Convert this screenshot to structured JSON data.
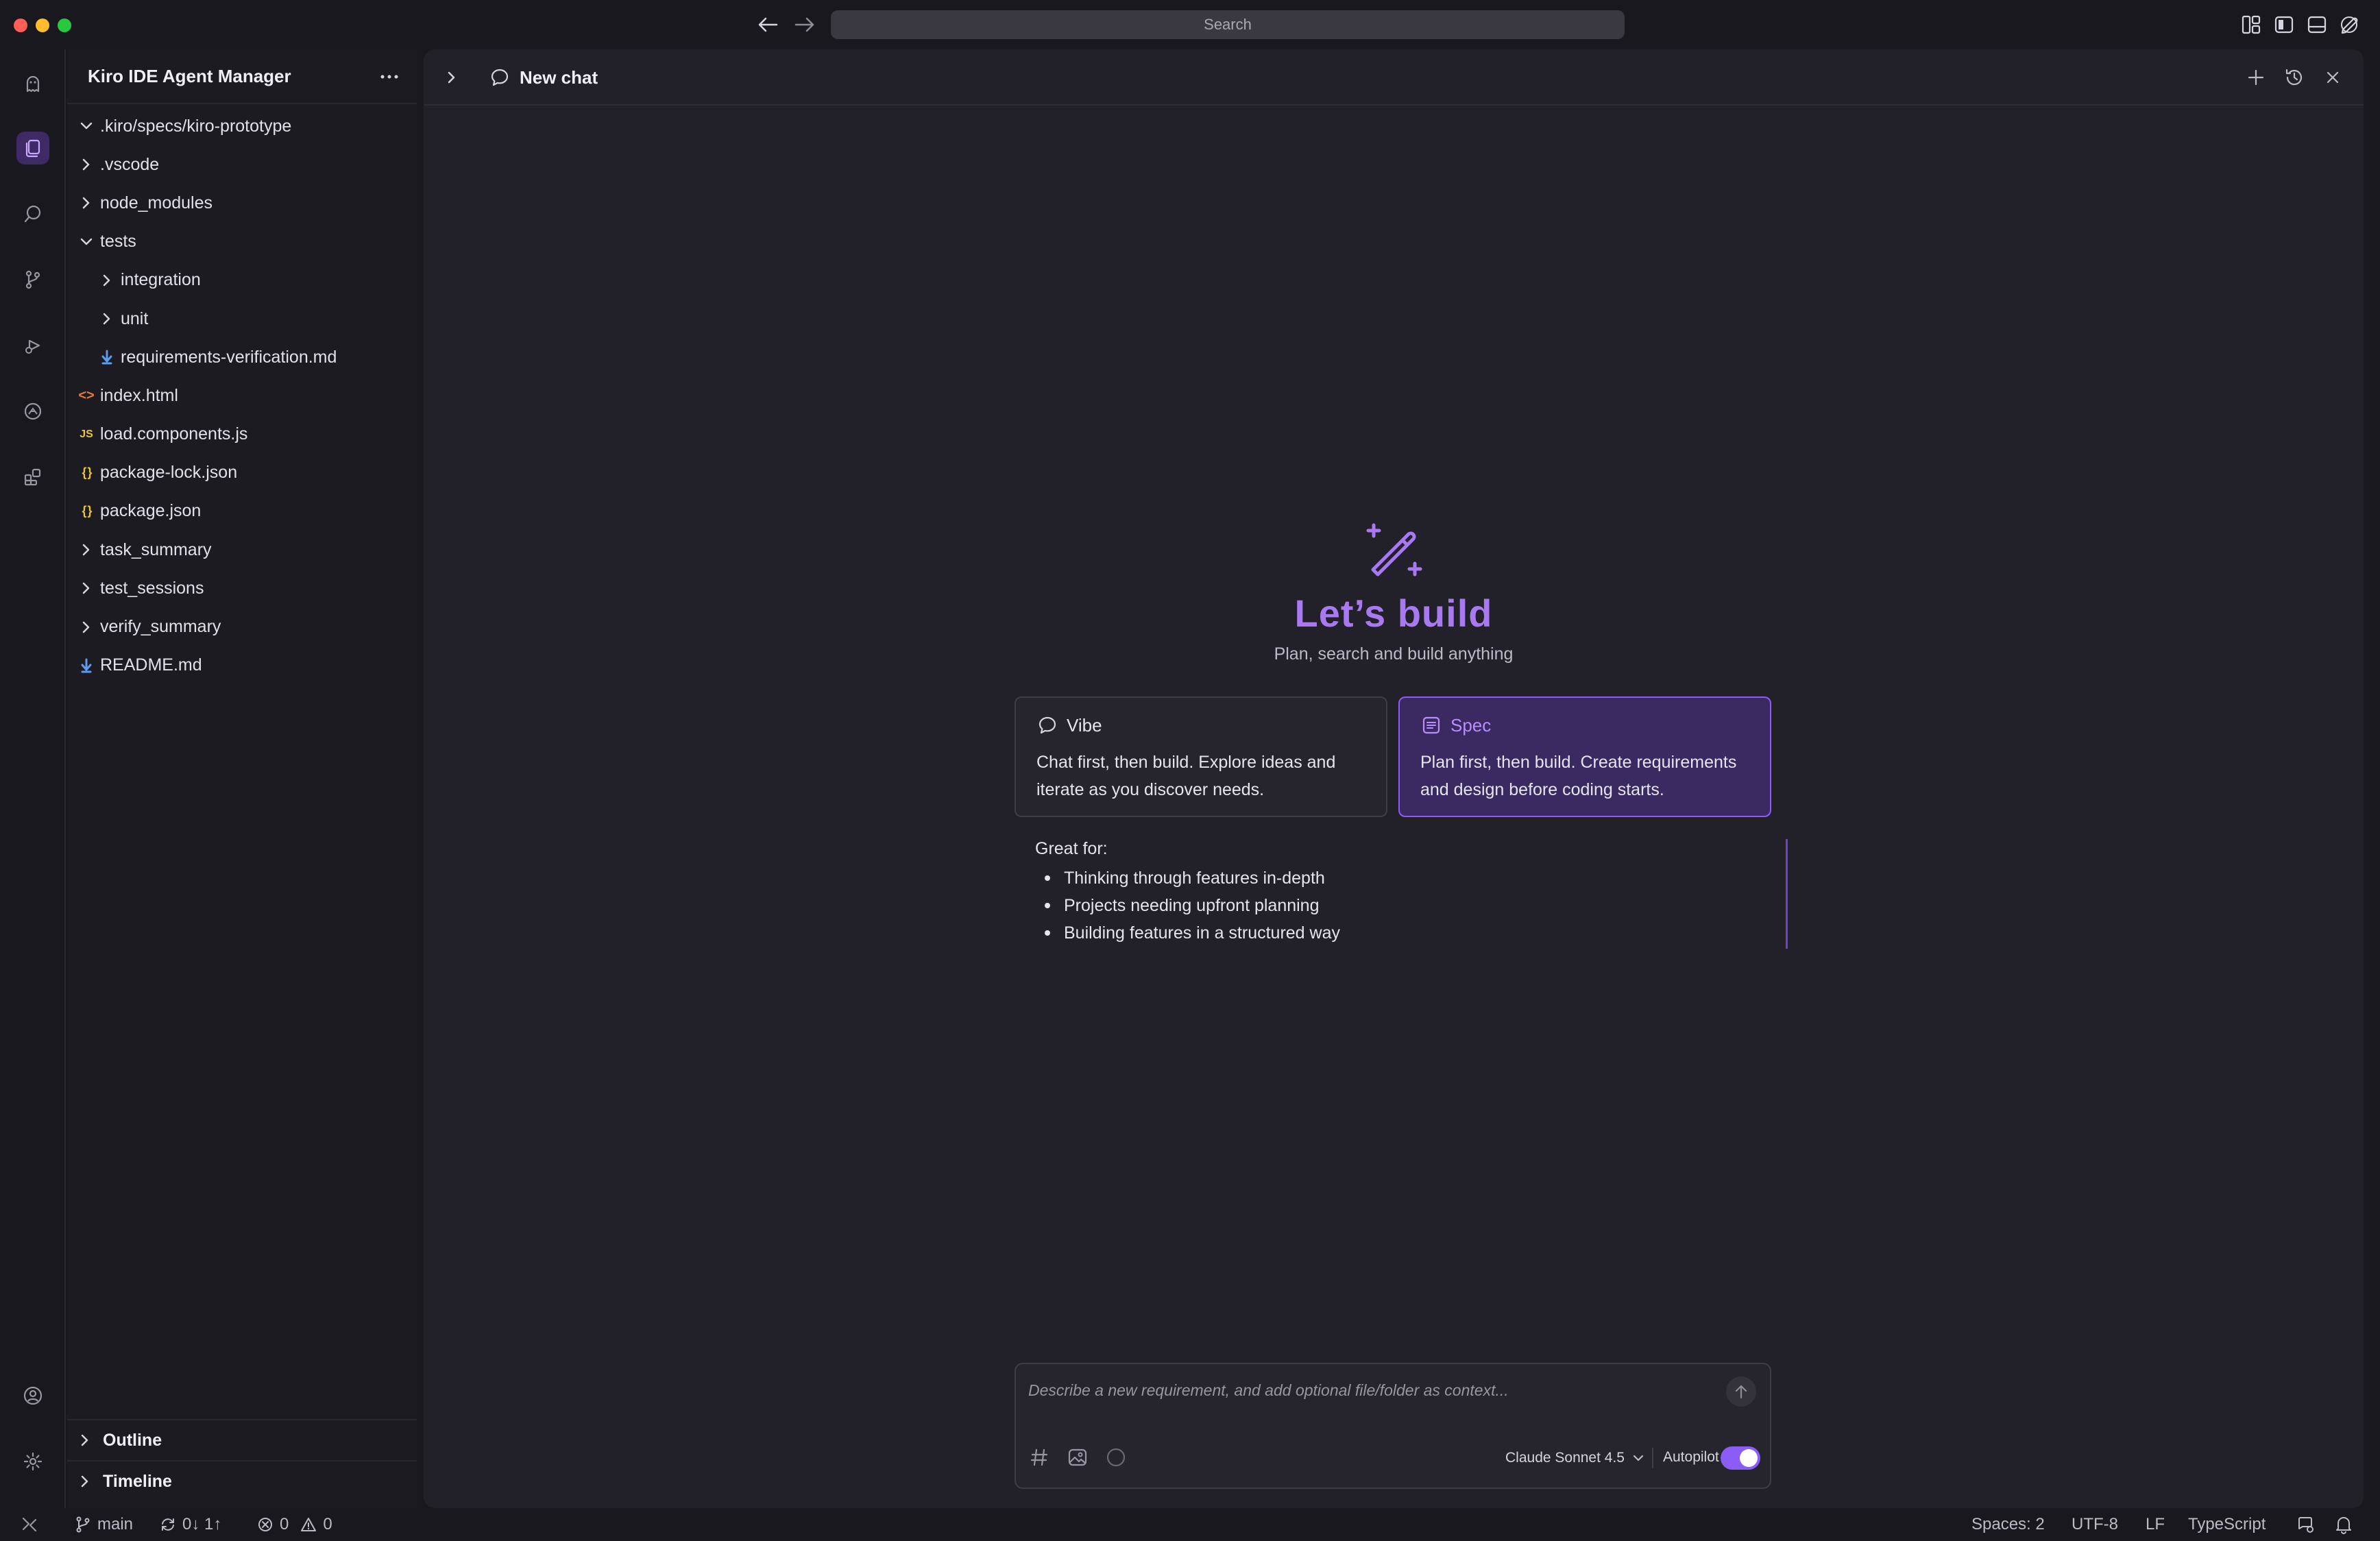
{
  "titlebar": {
    "search_label": "Search"
  },
  "sidebar": {
    "title": "Kiro IDE Agent Manager",
    "tree": [
      {
        "label": ".kiro/specs/kiro-prototype",
        "kind": "folder-open",
        "depth": 0
      },
      {
        "label": ".vscode",
        "kind": "folder",
        "depth": 0
      },
      {
        "label": "node_modules",
        "kind": "folder",
        "depth": 0
      },
      {
        "label": "tests",
        "kind": "folder-open",
        "depth": 0
      },
      {
        "label": "integration",
        "kind": "folder",
        "depth": 1
      },
      {
        "label": "unit",
        "kind": "folder",
        "depth": 1
      },
      {
        "label": "requirements-verification.md",
        "kind": "markdown",
        "depth": 1
      },
      {
        "label": "index.html",
        "kind": "html",
        "depth": 0
      },
      {
        "label": "load.components.js",
        "kind": "js",
        "depth": 0
      },
      {
        "label": "package-lock.json",
        "kind": "json",
        "depth": 0
      },
      {
        "label": "package.json",
        "kind": "json",
        "depth": 0
      },
      {
        "label": "task_summary",
        "kind": "folder",
        "depth": 0
      },
      {
        "label": "test_sessions",
        "kind": "folder",
        "depth": 0
      },
      {
        "label": "verify_summary",
        "kind": "folder",
        "depth": 0
      },
      {
        "label": "README.md",
        "kind": "markdown",
        "depth": 0
      }
    ],
    "icons": {
      "html": "<>",
      "js": "JS",
      "json": "{ }"
    },
    "outline_label": "Outline",
    "timeline_label": "Timeline"
  },
  "main": {
    "tab_title": "New chat",
    "hero_title": "Let’s build",
    "hero_subtitle": "Plan, search and build anything",
    "modes": {
      "vibe": {
        "label": "Vibe",
        "description": "Chat first, then build. Explore ideas and iterate as you discover needs."
      },
      "spec": {
        "label": "Spec",
        "description": "Plan first, then build. Create requirements and design before coding starts."
      }
    },
    "great_for": {
      "title": "Great for:",
      "items": [
        "Thinking through features in-depth",
        "Projects needing upfront planning",
        "Building features in a structured way"
      ]
    },
    "composer": {
      "placeholder": "Describe a new requirement, and add optional file/folder as context...",
      "value": "",
      "model": "Claude Sonnet 4.5",
      "autopilot_label": "Autopilot",
      "autopilot_on": true
    }
  },
  "statusbar": {
    "branch": "main",
    "sync": "0↓ 1↑",
    "errors": "0",
    "warnings": "0",
    "spaces": "Spaces: 2",
    "encoding": "UTF-8",
    "eol": "LF",
    "language": "TypeScript"
  },
  "colors": {
    "accent": "#8b5cf6",
    "accent_text": "#a879f0",
    "selected_card": "#3b2a62",
    "background": "#19181e",
    "panel": "#222129",
    "html_icon": "#e8793a",
    "js_icon": "#e8c43a",
    "json_icon": "#e8c43a",
    "markdown_icon": "#5b9bf0"
  }
}
